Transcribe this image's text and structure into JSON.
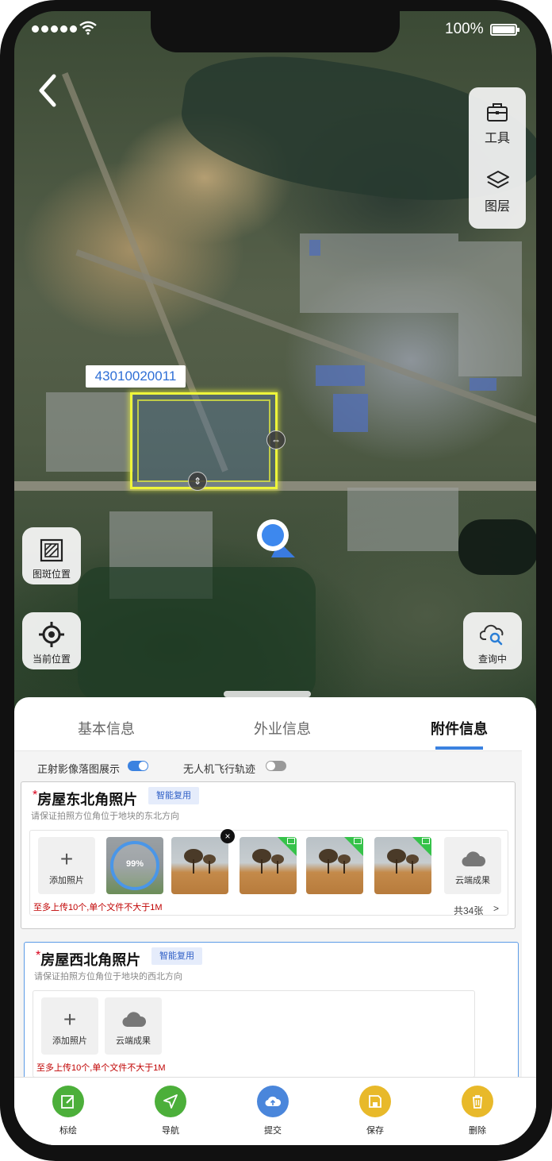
{
  "status_bar": {
    "battery": "100%"
  },
  "map": {
    "parcel_id": "43010020011",
    "tools": [
      {
        "label": "工具",
        "icon": "toolbox-icon"
      },
      {
        "label": "图层",
        "icon": "layers-icon"
      }
    ],
    "left_buttons": [
      {
        "label": "图斑位置",
        "icon": "parcel-location-icon"
      },
      {
        "label": "当前位置",
        "icon": "crosshair-icon"
      }
    ],
    "query_button": {
      "label": "查询中",
      "icon": "cloud-search-icon"
    }
  },
  "tabs": [
    {
      "label": "基本信息",
      "active": false
    },
    {
      "label": "外业信息",
      "active": false
    },
    {
      "label": "附件信息",
      "active": true
    }
  ],
  "toggles": [
    {
      "label": "正射影像落图展示",
      "on": true
    },
    {
      "label": "无人机飞行轨迹",
      "on": false
    }
  ],
  "cards": [
    {
      "required_mark": "*",
      "title": "房屋东北角照片",
      "badge": "智能复用",
      "hint": "请保证拍照方位角位于地块的东北方向",
      "add_label": "添加照片",
      "upload_progress": "99%",
      "cloud_label": "云端成果",
      "limit": "至多上传10个,单个文件不大于1M",
      "count": "共34张",
      "more": ">"
    },
    {
      "required_mark": "*",
      "title": "房屋西北角照片",
      "badge": "智能复用",
      "hint": "请保证拍照方位角位于地块的西北方向",
      "add_label": "添加照片",
      "cloud_label": "云端成果",
      "limit": "至多上传10个,单个文件不大于1M"
    }
  ],
  "actions": [
    {
      "label": "标绘",
      "color": "#4caf3a",
      "icon": "draw-icon"
    },
    {
      "label": "导航",
      "color": "#4caf3a",
      "icon": "navigation-icon"
    },
    {
      "label": "提交",
      "color": "#4a86db",
      "icon": "cloud-upload-icon"
    },
    {
      "label": "保存",
      "color": "#e8b92a",
      "icon": "save-icon"
    },
    {
      "label": "删除",
      "color": "#e8b92a",
      "icon": "trash-icon"
    }
  ],
  "colors": {
    "accent": "#3b82e0",
    "parcel_outline": "#eef53a",
    "required": "#d9001b",
    "limit_text": "#c00000"
  }
}
